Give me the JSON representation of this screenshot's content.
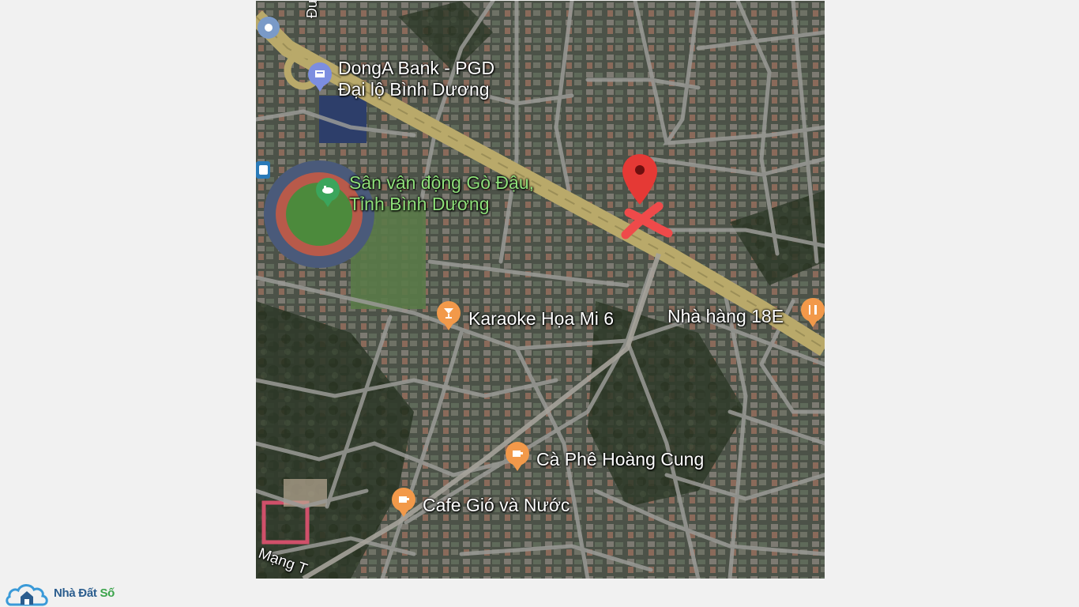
{
  "map": {
    "markers": [
      {
        "id": "donga",
        "label_lines": [
          "DongA Bank - PGD",
          "Đại lộ Bình Dương"
        ],
        "icon": "bank-icon",
        "color": "#7c8ee0"
      },
      {
        "id": "stadium",
        "label_lines": [
          "Sân vận động Gò Đậu,",
          "Tỉnh Bình Dương"
        ],
        "icon": "stadium-icon",
        "color": "#3ba55c"
      },
      {
        "id": "karaoke",
        "label": "Karaoke Họa Mi 6",
        "icon": "cocktail-icon",
        "color": "#f2994a"
      },
      {
        "id": "restaurant",
        "label": "Nhà hàng 18E",
        "icon": "restaurant-icon",
        "color": "#f2994a"
      },
      {
        "id": "hoangcung",
        "label": "Cà Phê Hoàng Cung",
        "icon": "coffee-icon",
        "color": "#f2994a"
      },
      {
        "id": "giovanuoc",
        "label": "Cafe Gió và Nước",
        "icon": "coffee-icon",
        "color": "#f2994a"
      }
    ],
    "street_labels": {
      "top": "Đườ",
      "bottom": "Mạng T"
    },
    "target_pin": {
      "icon": "location-pin-icon",
      "color": "#e53935"
    },
    "target_mark": {
      "icon": "x-mark-icon",
      "color": "#ef4a4a"
    }
  },
  "logo": {
    "part1": "Nhà Đất",
    "part2": "Số",
    "icon": "house-cloud-icon"
  }
}
